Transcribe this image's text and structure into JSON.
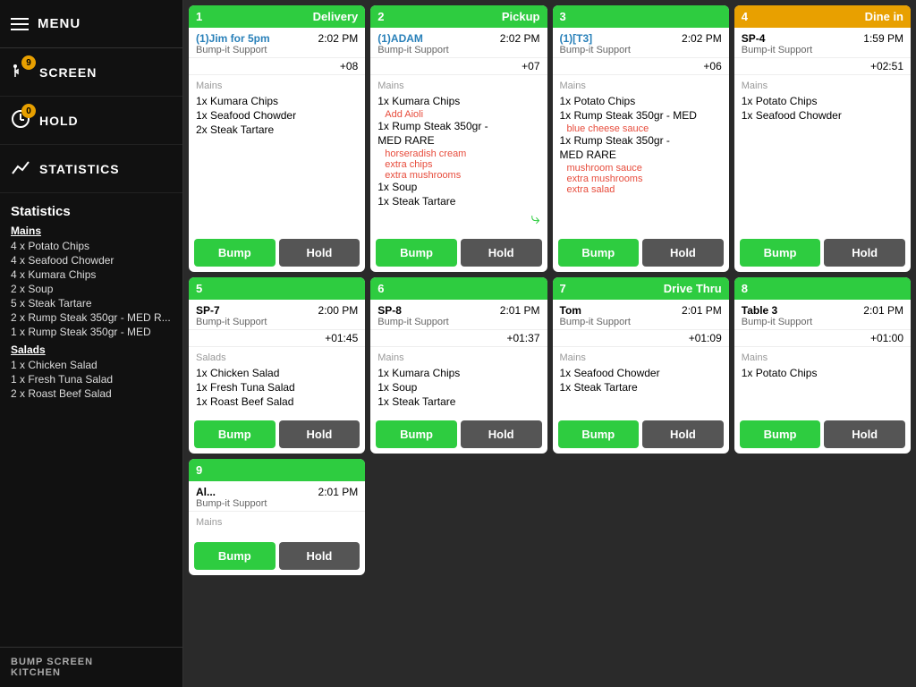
{
  "sidebar": {
    "menu_label": "MENU",
    "nav_items": [
      {
        "id": "screen",
        "label": "SCREEN",
        "badge": "9",
        "icon": "fork_knife"
      },
      {
        "id": "hold",
        "label": "HOLD",
        "badge": "0",
        "icon": "hold"
      },
      {
        "id": "statistics",
        "label": "STATISTICS",
        "icon": "stats"
      }
    ],
    "statistics": {
      "title": "Statistics",
      "categories": [
        {
          "name": "Mains",
          "items": [
            "4 x Potato Chips",
            "4 x Seafood Chowder",
            "4 x Kumara Chips",
            "2 x Soup",
            "5 x Steak Tartare",
            "2 x Rump Steak 350gr - MED R...",
            "1 x Rump Steak 350gr - MED"
          ]
        },
        {
          "name": "Salads",
          "items": [
            "1 x Chicken Salad",
            "1 x Fresh Tuna Salad",
            "2 x Roast Beef Salad"
          ]
        }
      ]
    },
    "footer_lines": [
      "BUMP SCREEN",
      "KITCHEN"
    ]
  },
  "orders": [
    {
      "number": "1",
      "type": "Delivery",
      "header_color": "green",
      "customer": "(1)Jim for 5pm",
      "customer_color": "blue",
      "support": "Bump-it Support",
      "time": "2:02 PM",
      "elapsed": "+08",
      "category": "Mains",
      "items": [
        {
          "text": "1x Kumara Chips",
          "modifiers": []
        },
        {
          "text": "1x Seafood Chowder",
          "modifiers": []
        },
        {
          "text": "2x Steak Tartare",
          "modifiers": []
        }
      ]
    },
    {
      "number": "2",
      "type": "Pickup",
      "header_color": "green",
      "customer": "(1)ADAM",
      "customer_color": "blue",
      "support": "Bump-it Support",
      "time": "2:02 PM",
      "elapsed": "+07",
      "category": "Mains",
      "items": [
        {
          "text": "1x Kumara Chips",
          "modifiers": []
        },
        {
          "text": "",
          "modifiers": [
            "Add Aioli"
          ]
        },
        {
          "text": "1x Rump Steak 350gr -",
          "modifiers": []
        },
        {
          "text": "MED RARE",
          "modifiers": []
        },
        {
          "text": "",
          "modifiers": [
            "horseradish cream",
            "extra chips",
            "extra mushrooms"
          ]
        },
        {
          "text": "1x Soup",
          "modifiers": []
        },
        {
          "text": "1x Steak Tartare",
          "modifiers": []
        }
      ],
      "has_more": true
    },
    {
      "number": "3",
      "type": "",
      "header_color": "green",
      "customer": "(1)[T3]",
      "customer_color": "blue",
      "support": "Bump-it Support",
      "time": "2:02 PM",
      "elapsed": "+06",
      "category": "Mains",
      "items": [
        {
          "text": "1x Potato Chips",
          "modifiers": []
        },
        {
          "text": "1x Rump Steak 350gr - MED",
          "modifiers": []
        },
        {
          "text": "",
          "modifiers": [
            "blue cheese sauce"
          ]
        },
        {
          "text": "1x Rump Steak 350gr -",
          "modifiers": []
        },
        {
          "text": "MED RARE",
          "modifiers": []
        },
        {
          "text": "",
          "modifiers": [
            "mushroom sauce",
            "extra mushrooms",
            "extra salad"
          ]
        }
      ]
    },
    {
      "number": "4",
      "type": "Dine in",
      "header_color": "orange",
      "customer": "SP-4",
      "customer_color": "normal",
      "support": "Bump-it Support",
      "time": "1:59 PM",
      "elapsed": "+02:51",
      "category": "Mains",
      "items": [
        {
          "text": "1x Potato Chips",
          "modifiers": []
        },
        {
          "text": "1x Seafood Chowder",
          "modifiers": []
        }
      ]
    },
    {
      "number": "5",
      "type": "",
      "header_color": "green",
      "customer": "SP-7",
      "customer_color": "normal",
      "support": "Bump-it Support",
      "time": "2:00 PM",
      "elapsed": "+01:45",
      "category": "Salads",
      "items": [
        {
          "text": "1x Chicken Salad",
          "modifiers": []
        },
        {
          "text": "1x Fresh Tuna Salad",
          "modifiers": []
        },
        {
          "text": "1x Roast Beef Salad",
          "modifiers": []
        }
      ]
    },
    {
      "number": "6",
      "type": "",
      "header_color": "green",
      "customer": "SP-8",
      "customer_color": "normal",
      "support": "Bump-it Support",
      "time": "2:01 PM",
      "elapsed": "+01:37",
      "category": "Mains",
      "items": [
        {
          "text": "1x Kumara Chips",
          "modifiers": []
        },
        {
          "text": "1x Soup",
          "modifiers": []
        },
        {
          "text": "1x Steak Tartare",
          "modifiers": []
        }
      ]
    },
    {
      "number": "7",
      "type": "Drive Thru",
      "header_color": "green",
      "customer": "Tom",
      "customer_color": "normal",
      "support": "Bump-it Support",
      "time": "2:01 PM",
      "elapsed": "+01:09",
      "category": "Mains",
      "items": [
        {
          "text": "1x Seafood Chowder",
          "modifiers": []
        },
        {
          "text": "1x Steak Tartare",
          "modifiers": []
        }
      ]
    },
    {
      "number": "8",
      "type": "",
      "header_color": "green",
      "customer": "Table 3",
      "customer_color": "normal",
      "support": "Bump-it Support",
      "time": "2:01 PM",
      "elapsed": "+01:00",
      "category": "Mains",
      "items": [
        {
          "text": "1x Potato Chips",
          "modifiers": []
        }
      ]
    },
    {
      "number": "9",
      "type": "",
      "header_color": "green",
      "customer": "Al...",
      "customer_color": "normal",
      "support": "Bump-it Support",
      "time": "2:01 PM",
      "elapsed": "",
      "category": "Mains",
      "items": []
    }
  ],
  "buttons": {
    "bump": "Bump",
    "hold": "Hold"
  }
}
